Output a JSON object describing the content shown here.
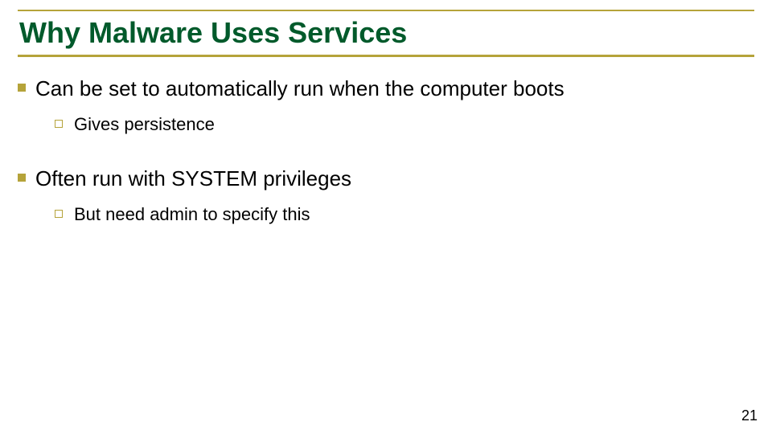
{
  "title": "Why Malware Uses Services",
  "bullets": [
    {
      "text": "Can be set to automatically run when the computer boots",
      "sub": [
        {
          "text": "Gives persistence"
        }
      ]
    },
    {
      "text": "Often run with SYSTEM privileges",
      "sub": [
        {
          "text": "But need admin to specify this"
        }
      ]
    }
  ],
  "page_number": "21"
}
